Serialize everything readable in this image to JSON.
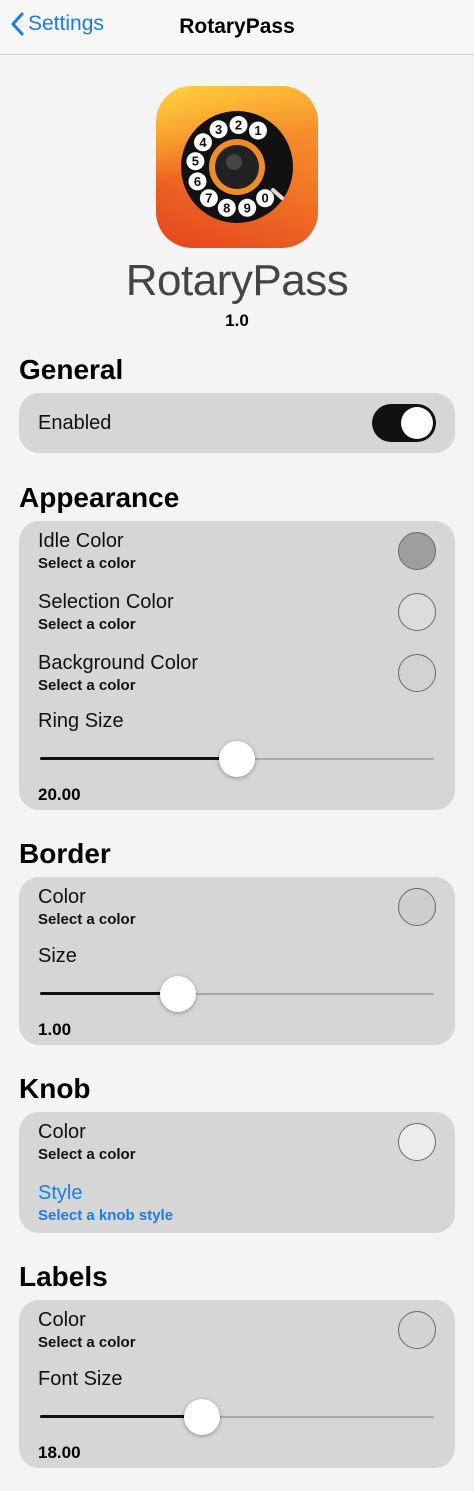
{
  "nav": {
    "back_label": "Settings",
    "title": "RotaryPass"
  },
  "header": {
    "app_name": "RotaryPass",
    "version": "1.0",
    "dial_digits": [
      "1",
      "2",
      "3",
      "4",
      "5",
      "6",
      "7",
      "8",
      "9",
      "0"
    ]
  },
  "general": {
    "title": "General",
    "enabled_label": "Enabled",
    "enabled": true
  },
  "appearance": {
    "title": "Appearance",
    "idle_color": {
      "label": "Idle Color",
      "sub": "Select a color",
      "color": "#9e9e9e"
    },
    "selection_color": {
      "label": "Selection Color",
      "sub": "Select a color",
      "color": "#dcdcdc"
    },
    "background_color": {
      "label": "Background Color",
      "sub": "Select a color",
      "color": "#d2d2d2"
    },
    "ring_size": {
      "label": "Ring Size",
      "value": "20.00",
      "fraction": 0.5
    }
  },
  "border": {
    "title": "Border",
    "color": {
      "label": "Color",
      "sub": "Select a color",
      "color": "#cecece"
    },
    "size": {
      "label": "Size",
      "value": "1.00",
      "fraction": 0.35
    }
  },
  "knob": {
    "title": "Knob",
    "color": {
      "label": "Color",
      "sub": "Select a color",
      "color": "#ececec"
    },
    "style": {
      "label": "Style",
      "sub": "Select a knob style"
    }
  },
  "labels": {
    "title": "Labels",
    "color": {
      "label": "Color",
      "sub": "Select a color",
      "color": "#d4d4d4"
    },
    "font_size": {
      "label": "Font Size",
      "value": "18.00",
      "fraction": 0.41
    }
  },
  "colors": {
    "accent": "#1a7cf2",
    "card": "#d6d6d6",
    "background": "#f4f4f4"
  }
}
